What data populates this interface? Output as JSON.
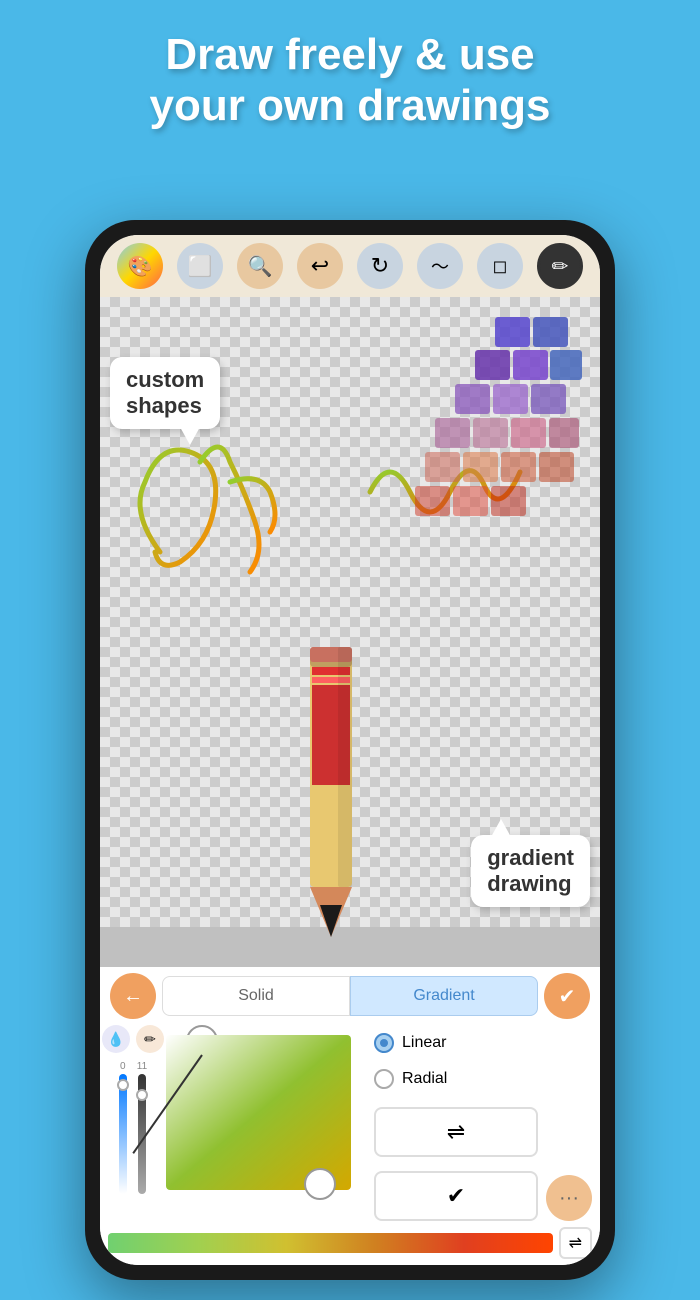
{
  "header": {
    "line1": "Draw freely & use",
    "line2": "your own drawings"
  },
  "toolbar": {
    "buttons": [
      {
        "name": "color-wheel",
        "label": "🎨",
        "type": "color"
      },
      {
        "name": "shape",
        "label": "⬜",
        "type": "shape"
      },
      {
        "name": "zoom",
        "label": "🔍",
        "type": "zoom"
      },
      {
        "name": "undo",
        "label": "↩",
        "type": "undo"
      },
      {
        "name": "redo",
        "label": "↻",
        "type": "redo"
      },
      {
        "name": "water",
        "label": "〜",
        "type": "water"
      },
      {
        "name": "erase",
        "label": "⬡",
        "type": "erase"
      },
      {
        "name": "pencil",
        "label": "✏",
        "type": "pencil"
      }
    ]
  },
  "canvas": {
    "tooltip_shapes": "custom\nshapes",
    "tooltip_gradient": "gradient\ndrawing"
  },
  "bottom_panel": {
    "tabs": [
      {
        "id": "solid",
        "label": "Solid",
        "active": false
      },
      {
        "id": "gradient",
        "label": "Gradient",
        "active": true
      }
    ],
    "opacity_label": "0",
    "pencil_label": "11",
    "radio_options": [
      {
        "id": "linear",
        "label": "Linear",
        "selected": true
      },
      {
        "id": "radial",
        "label": "Radial",
        "selected": false
      }
    ],
    "action_buttons": [
      {
        "name": "shuffle",
        "icon": "⇌"
      },
      {
        "name": "confirm",
        "icon": "✔"
      }
    ],
    "nav": {
      "back_label": "←",
      "confirm_label": "✔"
    },
    "more_label": "···"
  }
}
